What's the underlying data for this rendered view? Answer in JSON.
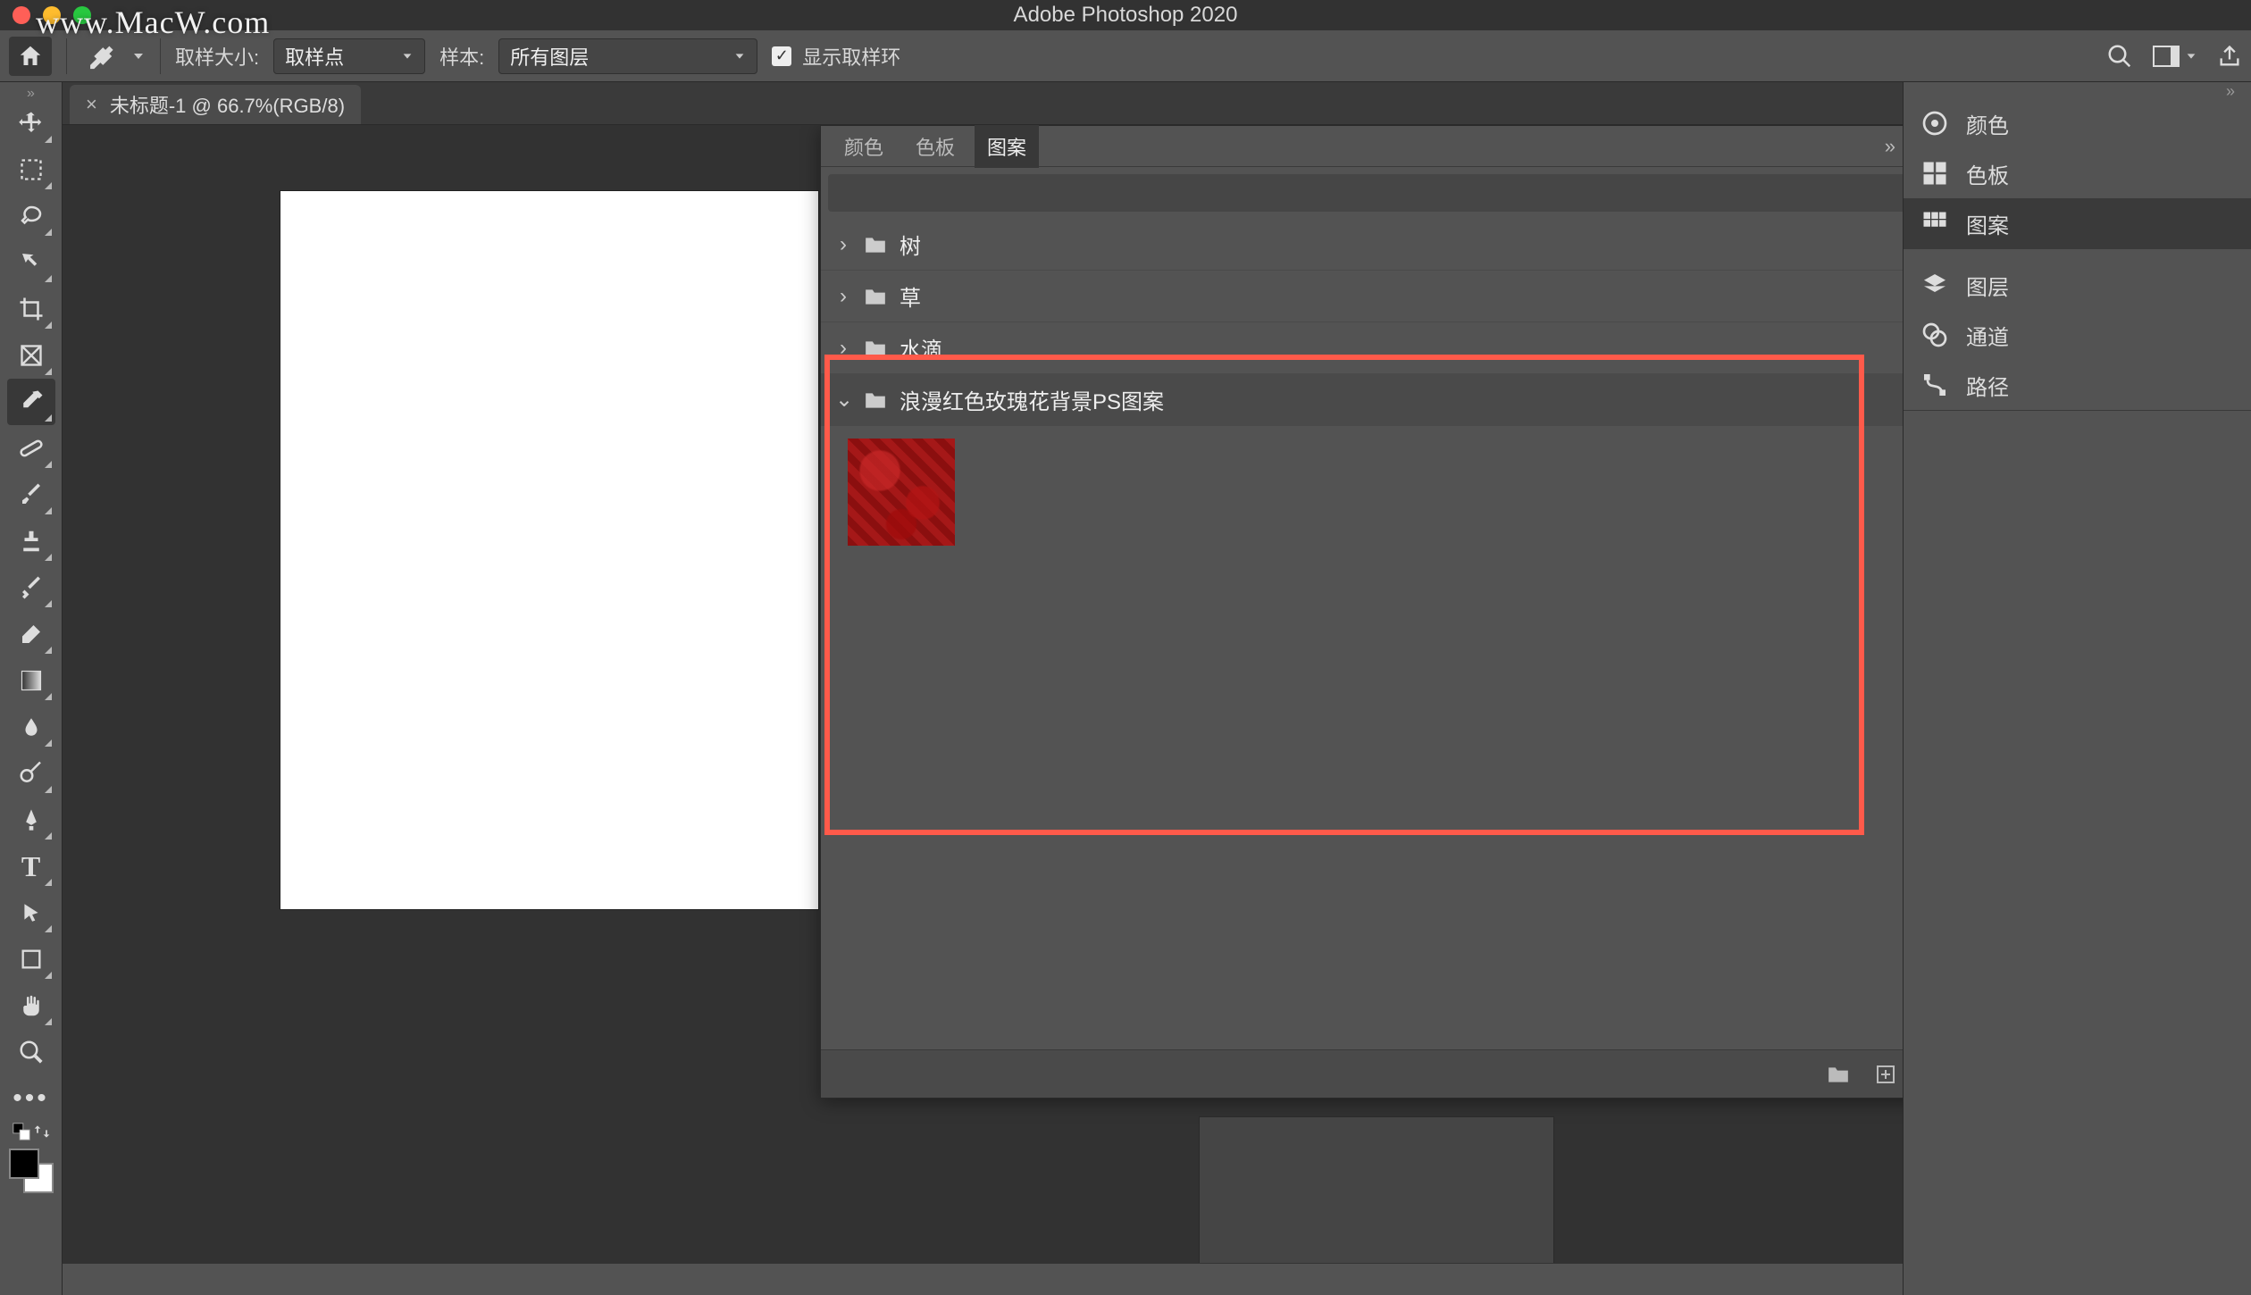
{
  "app_title": "Adobe Photoshop 2020",
  "watermark": "www.MacW.com",
  "optionsbar": {
    "sample_size_label": "取样大小:",
    "sample_size_value": "取样点",
    "sample_label": "样本:",
    "sample_value": "所有图层",
    "show_ring_label": "显示取样环"
  },
  "document": {
    "tab_title": "未标题-1 @ 66.7%(RGB/8)"
  },
  "patterns_panel": {
    "tabs": {
      "color": "颜色",
      "swatches": "色板",
      "patterns": "图案"
    },
    "folders": {
      "tree": "树",
      "grass": "草",
      "water": "水滴",
      "roses": "浪漫红色玫瑰花背景PS图案"
    }
  },
  "right_dock": {
    "color": "颜色",
    "swatches": "色板",
    "patterns": "图案",
    "layers": "图层",
    "channels": "通道",
    "paths": "路径"
  }
}
